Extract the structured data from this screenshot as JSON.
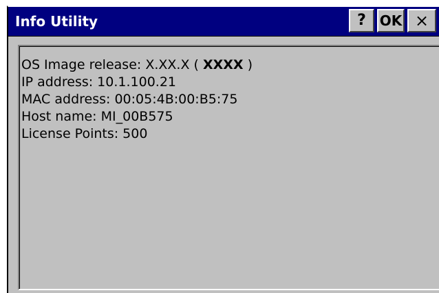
{
  "window": {
    "title": "Info Utility",
    "buttons": {
      "help": "?",
      "ok": "OK",
      "close": "×"
    }
  },
  "info": {
    "os_label": "OS Image release: ",
    "os_version": "X.XX.X",
    "os_build_open": " ( ",
    "os_build": "XXXX",
    "os_build_close": " )",
    "ip": "IP address: 10.1.100.21",
    "mac": "MAC address: 00:05:4B:00:B5:75",
    "host": "Host name: MI_00B575",
    "license": "License Points: 500"
  },
  "colors": {
    "titlebar": "#000080",
    "face": "#c0c0c0"
  }
}
